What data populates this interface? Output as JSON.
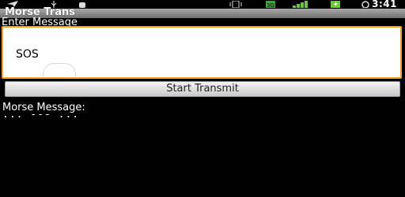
{
  "status_bar": {
    "time": "3:41",
    "icons": [
      "plane-notification-icon",
      "usb-icon",
      "android-debug-icon",
      "silent-vibrate-icon",
      "3g-signal-icon",
      "signal-strength-icon",
      "battery-charging-icon"
    ]
  },
  "app": {
    "title": "Morse Trans"
  },
  "form": {
    "prompt": "Enter Message",
    "input_value": "SOS",
    "button_label": "Start Transmit"
  },
  "output": {
    "label": "Morse Message:",
    "code": "... --- ..."
  },
  "colors": {
    "accent_focus": "#f7a21b",
    "background": "#000000",
    "titlebar": "#8a8a8a"
  }
}
